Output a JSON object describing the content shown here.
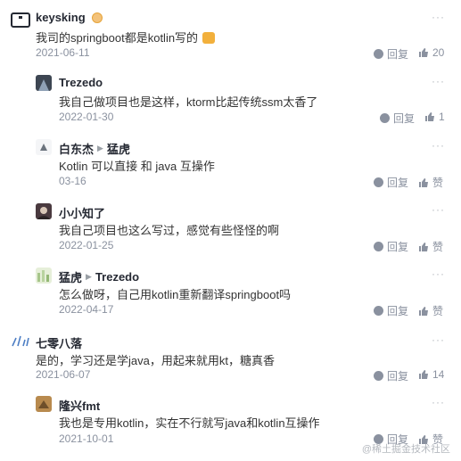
{
  "comments": [
    {
      "author": "keysking",
      "reply_to": "",
      "text": "我司的springboot都是kotlin写的",
      "date": "2021-06-11",
      "reply_label": "回复",
      "like_count": "20",
      "more": "···"
    },
    {
      "author": "Trezedo",
      "reply_to": "",
      "text": "我自己做项目也是这样，ktorm比起传统ssm太香了",
      "date": "2022-01-30",
      "reply_label": "回复",
      "like_count": "1",
      "more": "···"
    },
    {
      "author": "白东杰",
      "reply_to": "猛虎",
      "text": "Kotlin 可以直接 和 java 互操作",
      "date": "03-16",
      "reply_label": "回复",
      "like_count": "赞",
      "more": "···"
    },
    {
      "author": "小小知了",
      "reply_to": "",
      "text": "我自己项目也这么写过，感觉有些怪怪的啊",
      "date": "2022-01-25",
      "reply_label": "回复",
      "like_count": "赞",
      "more": "···"
    },
    {
      "author": "猛虎",
      "reply_to": "Trezedo",
      "text": "怎么做呀，自己用kotlin重新翻译springboot吗",
      "date": "2022-04-17",
      "reply_label": "回复",
      "like_count": "赞",
      "more": "···"
    },
    {
      "author": "七零八落",
      "reply_to": "",
      "text": "是的，学习还是学java，用起来就用kt，糖真香",
      "date": "2021-06-07",
      "reply_label": "回复",
      "like_count": "14",
      "more": "···"
    },
    {
      "author": "隆兴fmt",
      "reply_to": "",
      "text": "我也是专用kotlin，实在不行就写java和kotlin互操作",
      "date": "2021-10-01",
      "reply_label": "回复",
      "like_count": "赞",
      "more": "···"
    }
  ],
  "watermark": "@稀土掘金技术社区",
  "colors": {
    "meta": "#8a919f",
    "name": "#252933",
    "text": "#333333"
  },
  "icons": {
    "reply": "comment-bubble-icon",
    "like": "thumbs-up-icon",
    "more": "more-dots-icon"
  }
}
